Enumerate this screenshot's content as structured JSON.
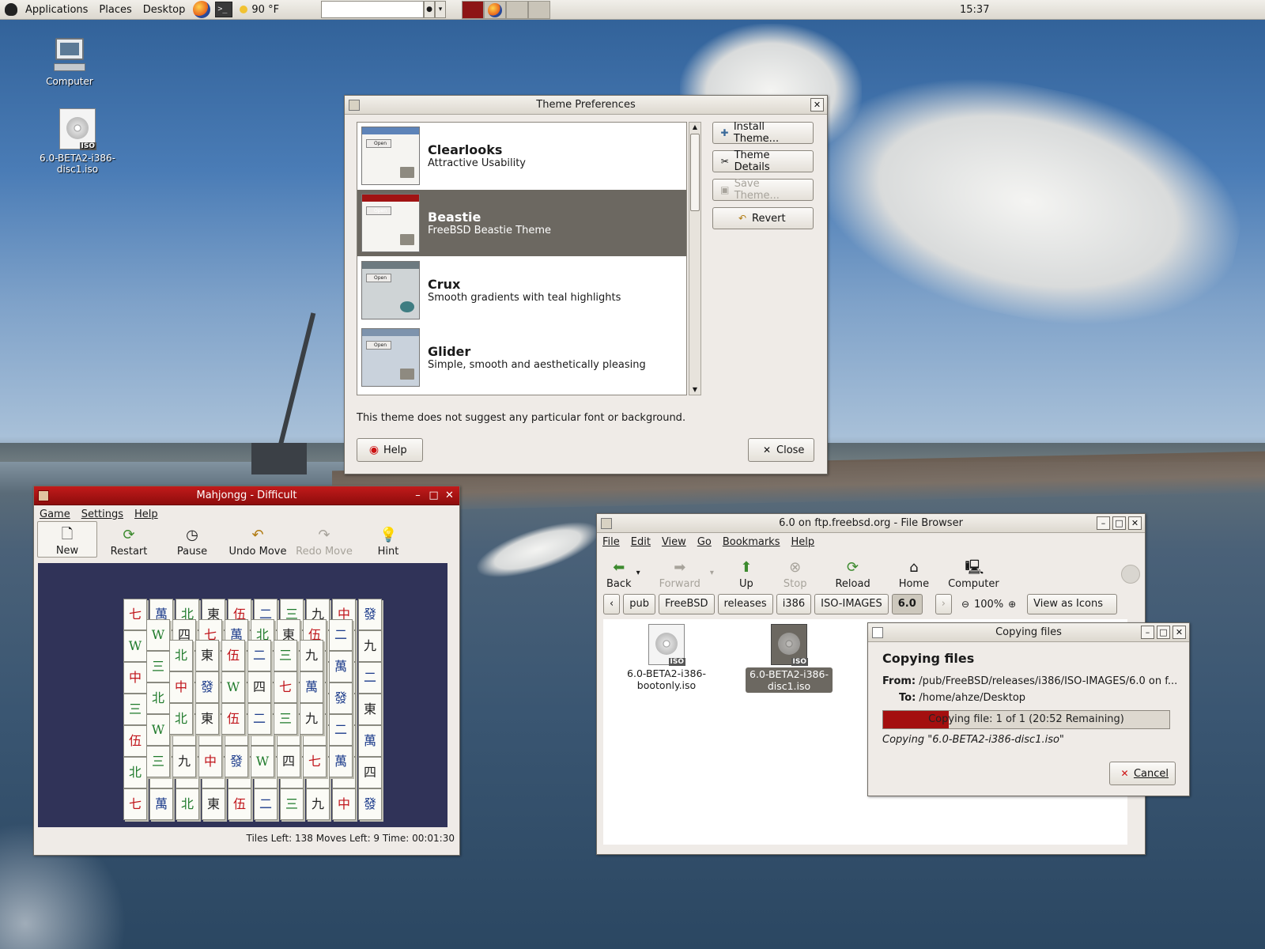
{
  "panel": {
    "applications": "Applications",
    "places": "Places",
    "desktop": "Desktop",
    "weather": "90 °F",
    "clock": "15:37",
    "terminal_glyph": ">_"
  },
  "desktop_icons": {
    "computer": "Computer",
    "iso_line1": "6.0-BETA2-i386-",
    "iso_line2": "disc1.iso",
    "iso_tag": "ISO"
  },
  "theme_prefs": {
    "title": "Theme Preferences",
    "themes": [
      {
        "name": "Clearlooks",
        "desc": "Attractive Usability",
        "open": "Open"
      },
      {
        "name": "Beastie",
        "desc": "FreeBSD Beastie Theme",
        "open": "Open"
      },
      {
        "name": "Crux",
        "desc": "Smooth gradients with teal highlights",
        "open": "Open"
      },
      {
        "name": "Glider",
        "desc": "Simple, smooth and aesthetically pleasing",
        "open": "Open"
      }
    ],
    "selected_index": 1,
    "buttons": {
      "install": "Install Theme...",
      "details": "Theme Details",
      "save": "Save Theme...",
      "revert": "Revert"
    },
    "note": "This theme does not suggest any particular font or background.",
    "help": "Help",
    "close": "Close"
  },
  "mahjongg": {
    "title": "Mahjongg - Difficult",
    "menu": [
      "Game",
      "Settings",
      "Help"
    ],
    "toolbar": {
      "new": "New",
      "restart": "Restart",
      "pause": "Pause",
      "undo": "Undo Move",
      "redo": "Redo Move",
      "hint": "Hint"
    },
    "status": "Tiles Left: 138   Moves Left:  9   Time: 00:01:30",
    "tiles": [
      "七",
      "萬",
      "北",
      "東",
      "伍",
      "二",
      "三",
      "九",
      "中",
      "發",
      "W",
      "四"
    ]
  },
  "file_browser": {
    "title": "6.0 on ftp.freebsd.org - File Browser",
    "menu": [
      "File",
      "Edit",
      "View",
      "Go",
      "Bookmarks",
      "Help"
    ],
    "toolbar": {
      "back": "Back",
      "forward": "Forward",
      "up": "Up",
      "stop": "Stop",
      "reload": "Reload",
      "home": "Home",
      "computer": "Computer"
    },
    "path": [
      "pub",
      "FreeBSD",
      "releases",
      "i386",
      "ISO-IMAGES",
      "6.0"
    ],
    "zoom": "100%",
    "view_mode": "View as Icons",
    "files": [
      {
        "line1": "6.0-BETA2-i386-",
        "line2": "bootonly.iso",
        "tag": "ISO"
      },
      {
        "line1": "6.0-BETA2-i386-",
        "line2": "disc1.iso",
        "tag": "ISO"
      }
    ]
  },
  "copy_dialog": {
    "title": "Copying files",
    "heading": "Copying files",
    "from_label": "From:",
    "from_value": "/pub/FreeBSD/releases/i386/ISO-IMAGES/6.0 on f...",
    "to_label": "To:",
    "to_value": "/home/ahze/Desktop",
    "progress_text": "Copying file: 1 of 1 (20:52 Remaining)",
    "progress_fraction": 0.23,
    "current": "Copying \"6.0-BETA2-i386-disc1.iso\"",
    "cancel": "Cancel"
  }
}
